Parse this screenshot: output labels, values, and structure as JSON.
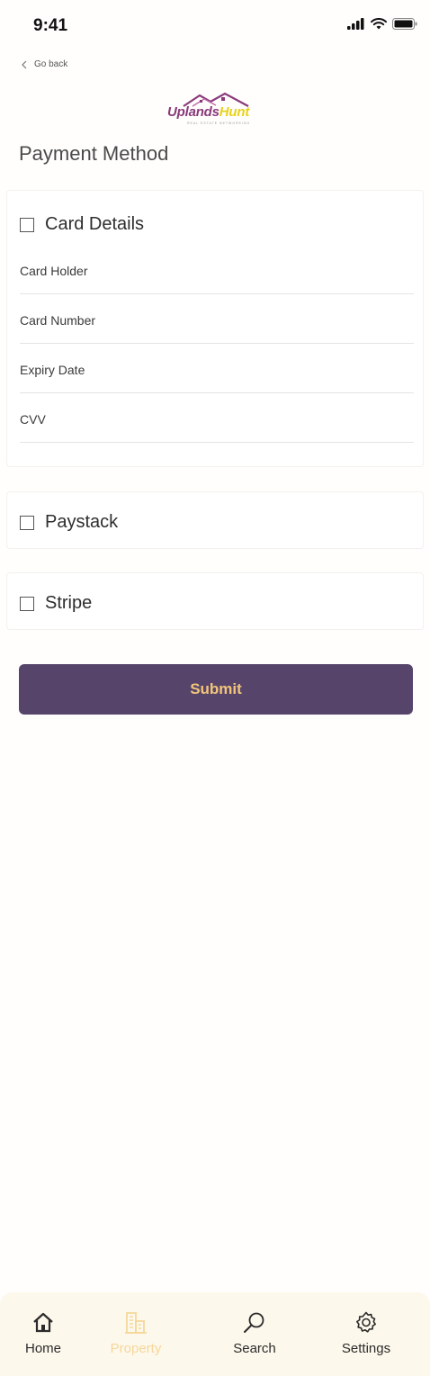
{
  "status": {
    "time": "9:41"
  },
  "nav": {
    "back_label": "Go back"
  },
  "logo": {
    "text_a": "Uplands",
    "text_b": "Hunt",
    "tagline": "REAL ESTATE NETWORKING"
  },
  "page": {
    "title": "Payment Method"
  },
  "payment": {
    "card_details_label": "Card Details",
    "fields": {
      "card_holder": "Card Holder",
      "card_number": "Card Number",
      "expiry": "Expiry Date",
      "cvv": "CVV"
    },
    "paystack_label": "Paystack",
    "stripe_label": "Stripe",
    "submit_label": "Submit"
  },
  "tabbar": {
    "home": "Home",
    "property": "Property",
    "search": "Search",
    "settings": "Settings",
    "active": "property"
  },
  "colors": {
    "brand_purple": "#56446b",
    "accent_gold": "#f2c57a",
    "logo_purple": "#8a3a7a",
    "logo_yellow": "#e8d21a",
    "navbar_bg": "#fdf8ec"
  },
  "icons": [
    "signal-icon",
    "wifi-icon",
    "battery-icon",
    "chevron-left-icon",
    "home-icon",
    "building-icon",
    "search-icon",
    "gear-icon"
  ]
}
